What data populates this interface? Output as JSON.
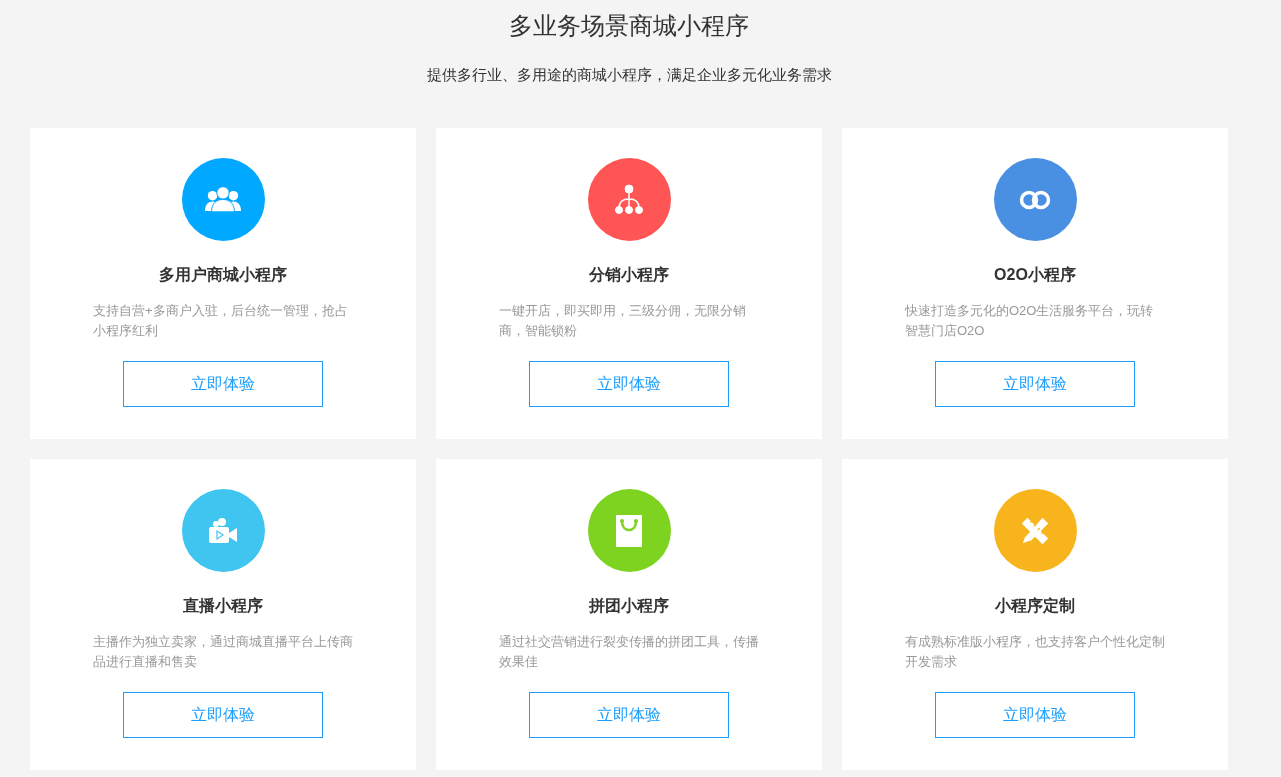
{
  "title": "多业务场景商城小程序",
  "subtitle": "提供多行业、多用途的商城小程序，满足企业多元化业务需求",
  "cards": [
    {
      "kind": "users",
      "color": "#00a8ff",
      "title": "多用户商城小程序",
      "description": "支持自营+多商户入驻，后台统一管理，抢占小程序红利",
      "button": "立即体验"
    },
    {
      "kind": "hierarchy",
      "color": "#ff5555",
      "title": "分销小程序",
      "description": "一键开店，即买即用，三级分佣，无限分销商，智能锁粉",
      "button": "立即体验"
    },
    {
      "kind": "rings",
      "color": "#4a90e2",
      "title": "O2O小程序",
      "description": "快速打造多元化的O2O生活服务平台，玩转智慧门店O2O",
      "button": "立即体验"
    },
    {
      "kind": "camera",
      "color": "#3fc5f0",
      "title": "直播小程序",
      "description": "主播作为独立卖家，通过商城直播平台上传商品进行直播和售卖",
      "button": "立即体验"
    },
    {
      "kind": "bag",
      "color": "#7ed321",
      "title": "拼团小程序",
      "description": "通过社交营销进行裂变传播的拼团工具，传播效果佳",
      "button": "立即体验"
    },
    {
      "kind": "tools",
      "color": "#f8b41c",
      "title": "小程序定制",
      "description": "有成熟标准版小程序，也支持客户个性化定制开发需求",
      "button": "立即体验"
    }
  ]
}
